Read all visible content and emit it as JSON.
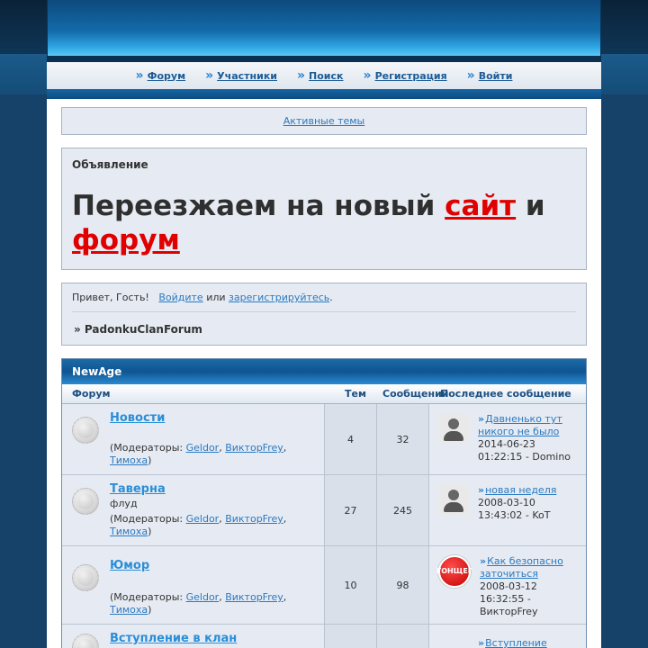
{
  "nav": {
    "items": [
      {
        "label": "Форум"
      },
      {
        "label": "Участники"
      },
      {
        "label": "Поиск"
      },
      {
        "label": "Регистрация"
      },
      {
        "label": "Войти"
      }
    ]
  },
  "active_topics": "Активные темы",
  "announcement": {
    "title": "Объявление",
    "text_part1": "Переезжаем на новый ",
    "text_red1": "сайт",
    "text_part2": " и ",
    "text_red2": "форум"
  },
  "welcome": {
    "greeting": "Привет, Гость!",
    "login_link": "Войдите",
    "or": "или",
    "register_link": "зарегистрируйтесь",
    "dot": ".",
    "breadcrumb": "» PadonkuClanForum"
  },
  "category": {
    "name": "NewAge",
    "col_forum": "Форум",
    "col_topics": "Тем",
    "col_posts": "Сообщений",
    "col_last": "Последнее сообщение"
  },
  "moderators_label": "(Модераторы: ",
  "forums": [
    {
      "name": "Новости",
      "desc": "",
      "mods": [
        "Geldor",
        "ВикторFrey",
        "Тимоха"
      ],
      "topics": "4",
      "posts": "32",
      "last_title": "Давненько тут никого не было",
      "last_meta": "2014-06-23 01:22:15 - Domino",
      "avatar": "default"
    },
    {
      "name": "Таверна",
      "desc": "флуд",
      "mods": [
        "Geldor",
        "ВикторFrey",
        "Тимоха"
      ],
      "topics": "27",
      "posts": "245",
      "last_title": "новая неделя",
      "last_meta": "2008-03-10 13:43:02 - KoT",
      "avatar": "default"
    },
    {
      "name": "Юмор",
      "desc": "",
      "mods": [
        "Geldor",
        "ВикторFrey",
        "Тимоха"
      ],
      "topics": "10",
      "posts": "98",
      "last_title": "Как безопасно заточиться",
      "last_meta": "2008-03-12 16:32:55 - ВикторFrey",
      "avatar": "red",
      "avatar_text": "ГОНЩЕГ"
    },
    {
      "name": "Вступление в клан",
      "desc": "",
      "mods": [],
      "topics": "",
      "posts": "",
      "last_title": "Вступление",
      "last_meta": "",
      "avatar": "none"
    }
  ]
}
